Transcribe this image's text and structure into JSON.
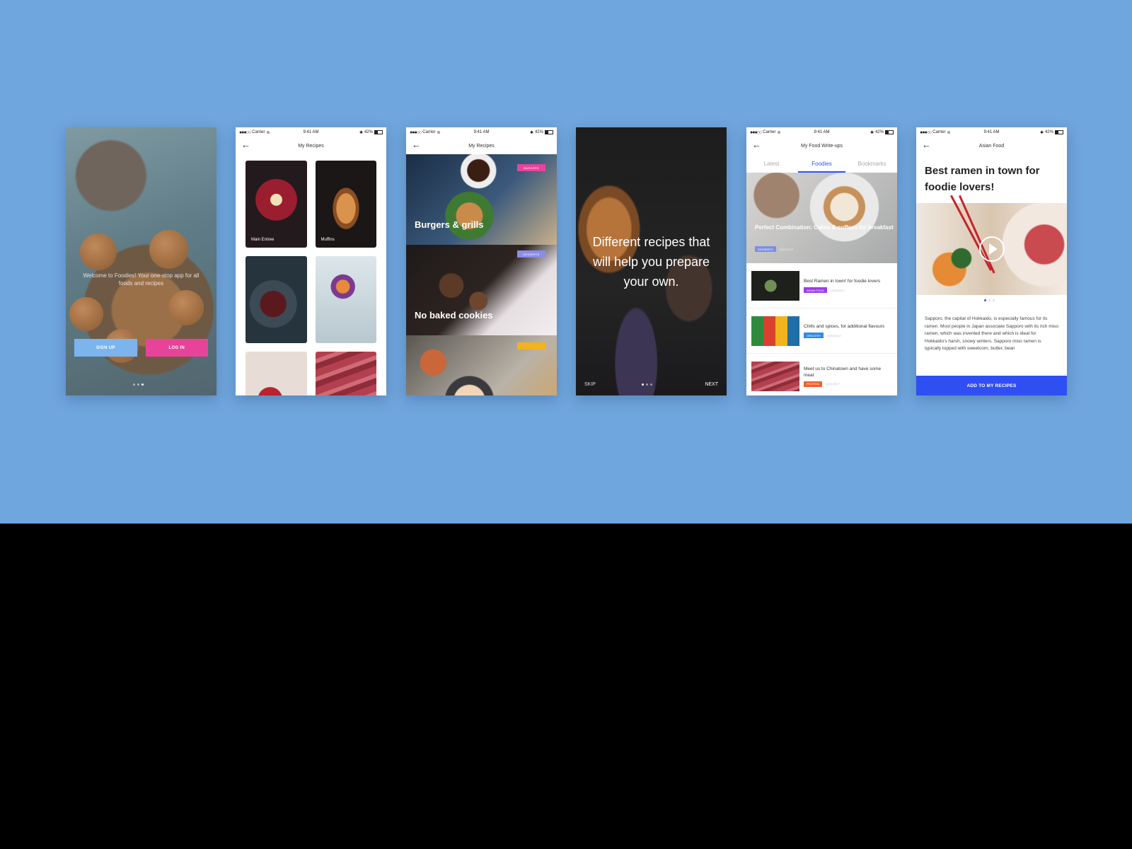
{
  "status_bar": {
    "carrier": "Carrier",
    "time": "9:41 AM",
    "battery": "42%"
  },
  "welcome": {
    "text": "Welcome to Foodies! Your one-stop app for all foods and recipes",
    "sign_up": "SIGN UP",
    "log_in": "LOG IN",
    "sign_up_color": "#7cb4ee",
    "log_in_color": "#e8439a"
  },
  "my_recipes": {
    "title": "My Recipes",
    "tiles": [
      {
        "label": "Main Entree"
      },
      {
        "label": "Muffins"
      },
      {
        "label": ""
      },
      {
        "label": ""
      },
      {
        "label": ""
      },
      {
        "label": ""
      }
    ]
  },
  "categories": {
    "title": "My Recipes",
    "cards": [
      {
        "title": "Burgers & grills",
        "tag": "BURGERS",
        "tag_color": "#e8439a"
      },
      {
        "title": "No baked cookies",
        "tag": "DESSERTS",
        "tag_color": "#8a8ee6"
      },
      {
        "title": "",
        "tag": "",
        "tag_color": "#f2b31c"
      }
    ]
  },
  "onboarding": {
    "text": "Different recipes that will help you prepare your own.",
    "skip": "SKIP",
    "next": "NEXT"
  },
  "writeups": {
    "title": "My Food Write-ups",
    "tabs": [
      "Latest",
      "Foodies",
      "Bookmarks"
    ],
    "active_tab": "Foodies",
    "accent": "#2f52ff",
    "hero": {
      "title": "Perfect Combination: Cakes & coffees for breakfast",
      "tag": "DESSERTS",
      "date": "20/01/2017"
    },
    "items": [
      {
        "title": "Best Ramen in town! for foodie lovers",
        "tag": "ASIAN FOOD",
        "tag_color": "#9b3de8",
        "date": "12/01/2017"
      },
      {
        "title": "Chills and spices, for additional flavours",
        "tag": "GROCERY",
        "tag_color": "#2e8be6",
        "date": "18/01/2017"
      },
      {
        "title": "Meet us to Chinatown and have some meat",
        "tag": "PROTEIN",
        "tag_color": "#f2602b",
        "date": "10/01/2017"
      }
    ]
  },
  "article": {
    "title": "Asian Food",
    "headline": "Best ramen in town for foodie lovers!",
    "body": "Sapporo, the capital of Hokkaido, is especially famous for its ramen. Most people in Japan associate Sapporo with its rich miso ramen, which was invented there and which is ideal for Hokkaido's harsh, snowy winters. Sapporo miso ramen is typically topped with sweetcorn, butter, bean",
    "cta": "ADD TO MY RECIPES",
    "cta_color": "#2f4ff2"
  }
}
